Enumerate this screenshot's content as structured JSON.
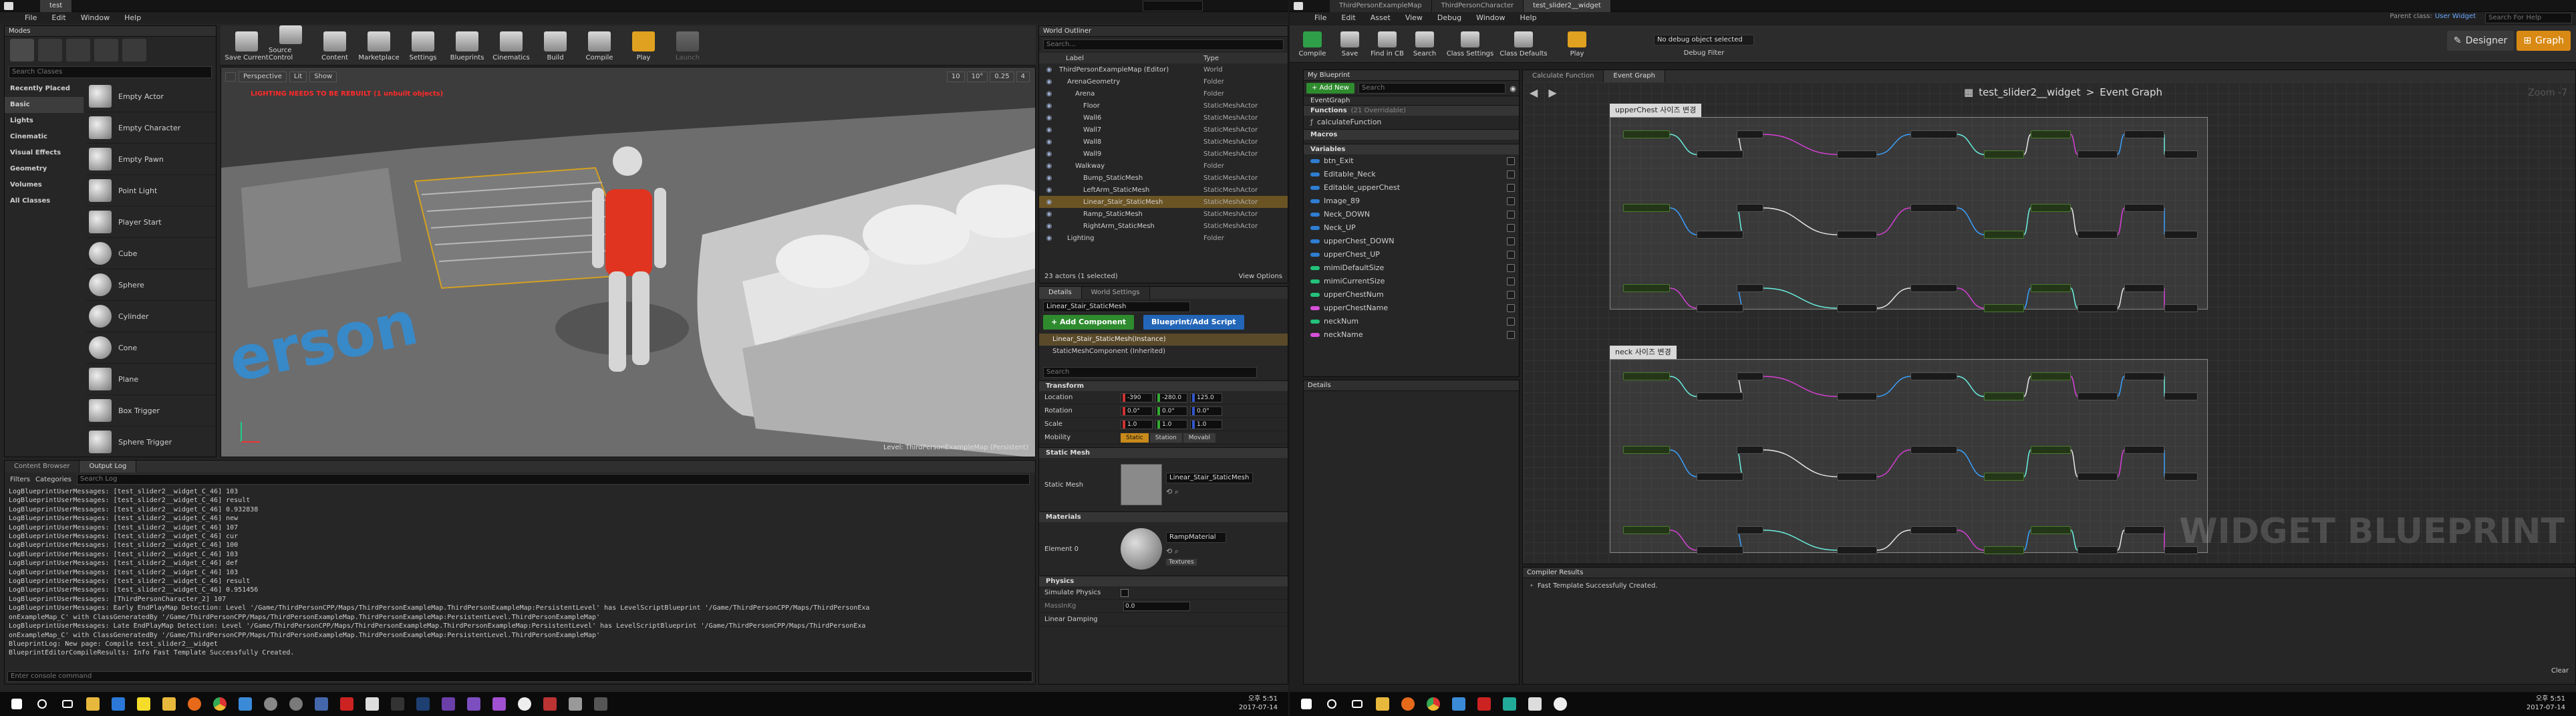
{
  "left_monitor": {
    "window_tab": "test",
    "menu": [
      "File",
      "Edit",
      "Window",
      "Help"
    ],
    "modes_header": "Modes",
    "search_classes_placeholder": "Search Classes",
    "categories": [
      "Recently Placed",
      "Basic",
      "Lights",
      "Cinematic",
      "Visual Effects",
      "Geometry",
      "Volumes",
      "All Classes"
    ],
    "selected_category": "Basic",
    "actors": [
      "Empty Actor",
      "Empty Character",
      "Empty Pawn",
      "Point Light",
      "Player Start",
      "Cube",
      "Sphere",
      "Cylinder",
      "Cone",
      "Plane",
      "Box Trigger",
      "Sphere Trigger"
    ],
    "toolbar": [
      "Save Current",
      "Source Control",
      "Content",
      "Marketplace",
      "Settings",
      "Blueprints",
      "Cinematics",
      "Build",
      "Compile",
      "Play",
      "Launch"
    ],
    "viewport": {
      "perspective": "Perspective",
      "lit": "Lit",
      "show": "Show",
      "warning": "LIGHTING NEEDS TO BE REBUILT (1 unbuilt objects)",
      "level_label": "Level:  ThirdPersonExampleMap (Persistent)",
      "snap_values": [
        "10",
        "10°",
        "0.25",
        "4"
      ]
    },
    "outliner": {
      "title": "World Outliner",
      "search_placeholder": "Search...",
      "col_label": "Label",
      "col_type": "Type",
      "rows": [
        {
          "label": "ThirdPersonExampleMap (Editor)",
          "type": "World",
          "indent": 0
        },
        {
          "label": "ArenaGeometry",
          "type": "Folder",
          "indent": 1
        },
        {
          "label": "Arena",
          "type": "Folder",
          "indent": 2
        },
        {
          "label": "Floor",
          "type": "StaticMeshActor",
          "indent": 3
        },
        {
          "label": "Wall6",
          "type": "StaticMeshActor",
          "indent": 3
        },
        {
          "label": "Wall7",
          "type": "StaticMeshActor",
          "indent": 3
        },
        {
          "label": "Wall8",
          "type": "StaticMeshActor",
          "indent": 3
        },
        {
          "label": "Wall9",
          "type": "StaticMeshActor",
          "indent": 3
        },
        {
          "label": "Walkway",
          "type": "Folder",
          "indent": 2
        },
        {
          "label": "Bump_StaticMesh",
          "type": "StaticMeshActor",
          "indent": 3
        },
        {
          "label": "LeftArm_StaticMesh",
          "type": "StaticMeshActor",
          "indent": 3
        },
        {
          "label": "Linear_Stair_StaticMesh",
          "type": "StaticMeshActor",
          "indent": 3,
          "selected": true
        },
        {
          "label": "Ramp_StaticMesh",
          "type": "StaticMeshActor",
          "indent": 3
        },
        {
          "label": "RightArm_StaticMesh",
          "type": "StaticMeshActor",
          "indent": 3
        },
        {
          "label": "Lighting",
          "type": "Folder",
          "indent": 1
        }
      ],
      "footer": "23 actors (1 selected)",
      "view_options": "View Options"
    },
    "details": {
      "tab_details": "Details",
      "tab_world": "World Settings",
      "name": "Linear_Stair_StaticMesh",
      "add_component": "+ Add Component",
      "blueprint_btn": "Blueprint/Add Script",
      "components": [
        "Linear_Stair_StaticMesh(Instance)",
        "StaticMeshComponent (Inherited)"
      ],
      "search_placeholder": "Search",
      "transform": "Transform",
      "location_label": "Location",
      "rotation_label": "Rotation",
      "scale_label": "Scale",
      "mobility_label": "Mobility",
      "location": [
        "-390",
        "-280.0",
        "125.0"
      ],
      "rotation": [
        "0.0°",
        "0.0°",
        "0.0°"
      ],
      "scale": [
        "1.0",
        "1.0",
        "1.0"
      ],
      "mobility": [
        "Static",
        "Station",
        "Movabl"
      ],
      "static_mesh_section": "Static Mesh",
      "static_mesh_label": "Static Mesh",
      "static_mesh_value": "Linear_Stair_StaticMesh",
      "materials_section": "Materials",
      "element0_label": "Element 0",
      "element0_value": "RampMaterial",
      "textures": "Textures",
      "physics_section": "Physics",
      "simulate_physics": "Simulate Physics",
      "mass_label": "MassInKg",
      "mass_value": "0.0",
      "linear_damping": "Linear Damping"
    },
    "content_browser_tab": "Content Browser",
    "output_log_tab": "Output Log",
    "filters": "Filters",
    "categories_btn": "Categories",
    "log_search_placeholder": "Search Log",
    "log_lines": [
      "LogBlueprintUserMessages: [test_slider2__widget_C_46] 103",
      "LogBlueprintUserMessages: [test_slider2__widget_C_46] result",
      "LogBlueprintUserMessages: [test_slider2__widget_C_46] 0.932838",
      "LogBlueprintUserMessages: [test_slider2__widget_C_46] new",
      "LogBlueprintUserMessages: [test_slider2__widget_C_46] 107",
      "LogBlueprintUserMessages: [test_slider2__widget_C_46] cur",
      "LogBlueprintUserMessages: [test_slider2__widget_C_46] 100",
      "LogBlueprintUserMessages: [test_slider2__widget_C_46] 103",
      "LogBlueprintUserMessages: [test_slider2__widget_C_46] def",
      "LogBlueprintUserMessages: [test_slider2__widget_C_46] 103",
      "LogBlueprintUserMessages: [test_slider2__widget_C_46] result",
      "LogBlueprintUserMessages: [test_slider2__widget_C_46] 0.951456",
      "LogBlueprintUserMessages: [ThirdPersonCharacter_2] 107",
      "LogBlueprintUserMessages: Early EndPlayMap Detection: Level '/Game/ThirdPersonCPP/Maps/ThirdPersonExampleMap.ThirdPersonExampleMap:PersistentLevel' has LevelScriptBlueprint '/Game/ThirdPersonCPP/Maps/ThirdPersonExa",
      "onExampleMap_C' with ClassGeneratedBy '/Game/ThirdPersonCPP/Maps/ThirdPersonExampleMap.ThirdPersonExampleMap:PersistentLevel.ThirdPersonExampleMap'",
      "LogBlueprintUserMessages: Late EndPlayMap Detection: Level '/Game/ThirdPersonCPP/Maps/ThirdPersonExampleMap.ThirdPersonExampleMap:PersistentLevel' has LevelScriptBlueprint '/Game/ThirdPersonCPP/Maps/ThirdPersonExa",
      "onExampleMap_C' with ClassGeneratedBy '/Game/ThirdPersonCPP/Maps/ThirdPersonExampleMap.ThirdPersonExampleMap:PersistentLevel.ThirdPersonExampleMap'",
      "BlueprintLog: New page: Compile test_slider2__widget",
      "BlueprintEditorCompileResults: Info Fast Template Successfully Created."
    ],
    "console_placeholder": "Enter console command",
    "clock_time": "오후 5:51",
    "clock_date": "2017-07-14"
  },
  "right_monitor": {
    "tabs": [
      "ThirdPersonExampleMap",
      "ThirdPersonCharacter",
      "test_slider2__widget"
    ],
    "menu": [
      "File",
      "Edit",
      "Asset",
      "View",
      "Debug",
      "Window",
      "Help"
    ],
    "search_help": "Search For Help",
    "parent_class_label": "Parent class:",
    "parent_class": "User Widget",
    "toolbar": [
      "Compile",
      "Save",
      "Find in CB",
      "Search",
      "Class Settings",
      "Class Defaults",
      "Play"
    ],
    "debug_select": "No debug object selected",
    "debug_filter": "Debug Filter",
    "designer": "Designer",
    "graph": "Graph",
    "my_blueprint": "My Blueprint",
    "add_new": "+ Add New",
    "search_placeholder": "Search",
    "event_graph_item": "EventGraph",
    "functions_header": "Functions",
    "functions_count": "(21 Overridable)",
    "functions": [
      "calculateFunction"
    ],
    "macros_header": "Macros",
    "variables_header": "Variables",
    "variables": [
      {
        "name": "btn_Exit",
        "color": "#2f7dd1"
      },
      {
        "name": "Editable_Neck",
        "color": "#2f7dd1"
      },
      {
        "name": "Editable_upperChest",
        "color": "#2f7dd1"
      },
      {
        "name": "Image_89",
        "color": "#2f7dd1"
      },
      {
        "name": "Neck_DOWN",
        "color": "#2f7dd1"
      },
      {
        "name": "Neck_UP",
        "color": "#2f7dd1"
      },
      {
        "name": "upperChest_DOWN",
        "color": "#2f7dd1"
      },
      {
        "name": "upperChest_UP",
        "color": "#2f7dd1"
      },
      {
        "name": "mimiDefaultSize",
        "color": "#22c27a"
      },
      {
        "name": "mimiCurrentSize",
        "color": "#22c27a"
      },
      {
        "name": "upperChestNum",
        "color": "#22c27a"
      },
      {
        "name": "upperChestName",
        "color": "#d84fd8"
      },
      {
        "name": "neckNum",
        "color": "#22c27a"
      },
      {
        "name": "neckName",
        "color": "#d84fd8"
      }
    ],
    "details_tab": "Details",
    "graph_tabs": [
      "Calculate Function",
      "Event Graph"
    ],
    "breadcrumb_bp": "test_slider2__widget",
    "breadcrumb_sep": ">",
    "breadcrumb_graph": "Event Graph",
    "zoom": "Zoom -7",
    "comment1": "upperChest 사이즈 변경",
    "comment2": "neck 사이즈 변경",
    "watermark": "WIDGET BLUEPRINT",
    "compiler_results": "Compiler Results",
    "compile_msg": "Fast Template Successfully Created.",
    "clear": "Clear",
    "clock_time": "오후 5:51",
    "clock_date": "2017-07-14"
  }
}
